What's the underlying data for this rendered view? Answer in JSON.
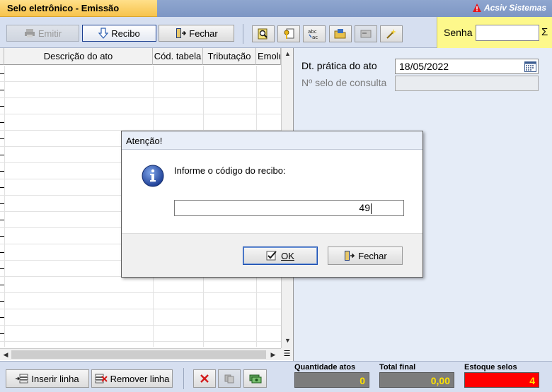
{
  "window": {
    "title": "Selo eletrônico - Emissão",
    "brand": "Acsiv Sistemas"
  },
  "toolbar": {
    "emitir_label": "Emitir",
    "recibo_label": "Recibo",
    "fechar_label": "Fechar",
    "icon_buttons": [
      "search-doc-icon",
      "key-doc-icon",
      "spell-check-icon",
      "folder-open-icon",
      "card-icon",
      "magic-wand-icon"
    ]
  },
  "senha": {
    "label": "Senha",
    "value": "",
    "sigma": "Σ"
  },
  "grid": {
    "columns": [
      "Descrição do ato",
      "Cód. tabela",
      "Tributação",
      "Emolu"
    ]
  },
  "form": {
    "dt_label": "Dt. prática do ato",
    "dt_value": "18/05/2022",
    "selo_label": "Nº selo de consulta",
    "selo_value": ""
  },
  "bottombar": {
    "inserir_label": "Inserir linha",
    "remover_label": "Remover linha"
  },
  "totals": {
    "quantidade_label": "Quantidade atos",
    "quantidade_value": "0",
    "total_label": "Total final",
    "total_value": "0,00",
    "estoque_label": "Estoque selos",
    "estoque_value": "4"
  },
  "dialog": {
    "title": "Atenção!",
    "message": "Informe o código do recibo:",
    "input_value": "49",
    "ok_label": "OK",
    "fechar_label": "Fechar"
  },
  "colors": {
    "accent_yellow": "#f7c34c",
    "senha_bg": "#fdf88b",
    "stock_red": "#ff0000",
    "total_text": "#ffe200"
  }
}
